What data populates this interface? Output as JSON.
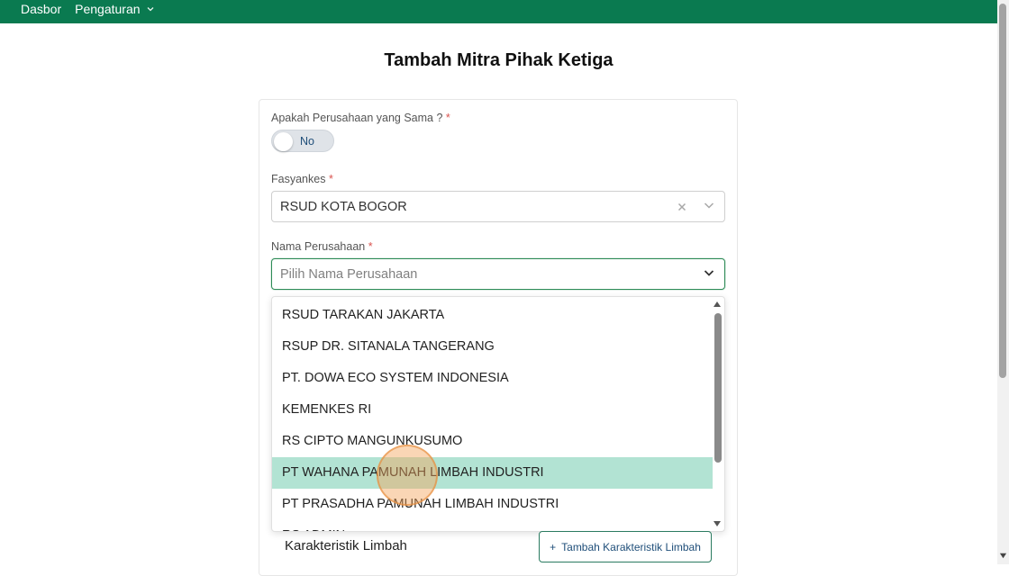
{
  "nav": {
    "items": [
      {
        "label": "Dasbor"
      },
      {
        "label": "Pengaturan"
      }
    ]
  },
  "page": {
    "title": "Tambah Mitra Pihak Ketiga"
  },
  "form": {
    "same_company": {
      "label": "Apakah Perusahaan yang Sama ?",
      "required": "*",
      "toggle_value": "No"
    },
    "fasyankes": {
      "label": "Fasyankes",
      "required": "*",
      "value": "RSUD KOTA BOGOR"
    },
    "company_name": {
      "label": "Nama Perusahaan",
      "required": "*",
      "placeholder": "Pilih Nama Perusahaan",
      "options": [
        "RSUD TARAKAN JAKARTA",
        "RSUP DR. SITANALA TANGERANG",
        "PT. DOWA ECO SYSTEM INDONESIA",
        "KEMENKES RI",
        "RS CIPTO MANGUNKUSUMO",
        "PT WAHANA PAMUNAH LIMBAH INDUSTRI",
        "PT PRASADHA PAMUNAH LIMBAH INDUSTRI",
        "RS ADMIN"
      ],
      "highlighted_option": "PT WAHANA PAMUNAH LIMBAH INDUSTRI"
    },
    "waste": {
      "section_title": "Karakteristik Limbah",
      "add_button_label": "Tambah Karakteristik Limbah",
      "add_button_icon": "+"
    }
  },
  "colors": {
    "topbar": "#0a7a50",
    "highlight": "#b2e3d3",
    "focus_border": "#2e8b57",
    "required": "#d9534f"
  }
}
